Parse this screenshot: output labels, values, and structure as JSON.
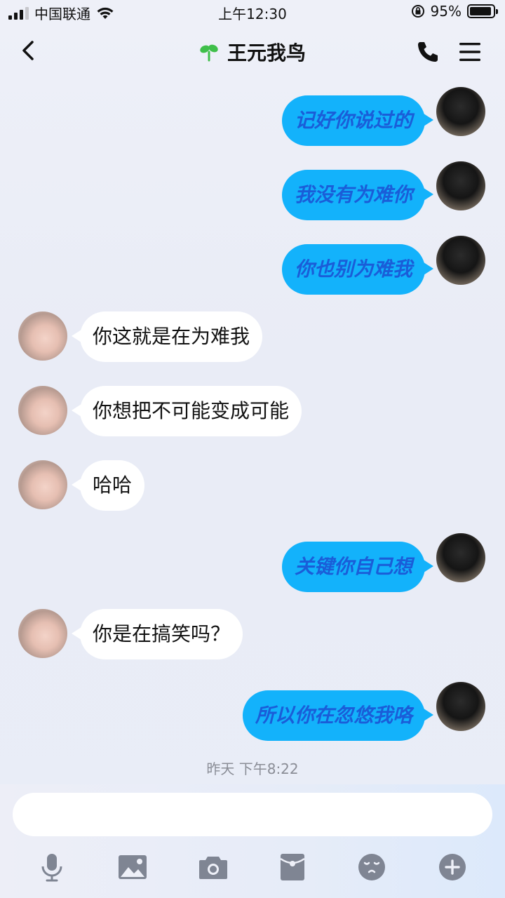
{
  "status_bar": {
    "carrier": "中国联通",
    "time": "上午12:30",
    "battery_percent": "95%",
    "battery_level": 0.95
  },
  "header": {
    "title": "王元我鸟"
  },
  "messages": [
    {
      "sender": "me",
      "text": "记好你说过的"
    },
    {
      "sender": "me",
      "text": "我没有为难你"
    },
    {
      "sender": "me",
      "text": "你也别为难我"
    },
    {
      "sender": "them",
      "text": "你这就是在为难我"
    },
    {
      "sender": "them",
      "text": "你想把不可能变成可能"
    },
    {
      "sender": "them",
      "text": "哈哈"
    },
    {
      "sender": "me",
      "text": "关键你自己想"
    },
    {
      "sender": "them",
      "text": "你是在搞笑吗？"
    },
    {
      "sender": "me",
      "text": "所以你在忽悠我咯"
    }
  ],
  "timestamp": "昨天 下午8:22",
  "input": {
    "placeholder": ""
  },
  "toolbar": {
    "items": [
      "microphone-icon",
      "image-icon",
      "camera-icon",
      "red-packet-icon",
      "emoji-icon",
      "plus-icon"
    ]
  },
  "colors": {
    "my_bubble": "#13b2fb",
    "my_text": "#1a5dd8",
    "their_bubble": "#ffffff",
    "icon_gray": "#7f8593"
  }
}
